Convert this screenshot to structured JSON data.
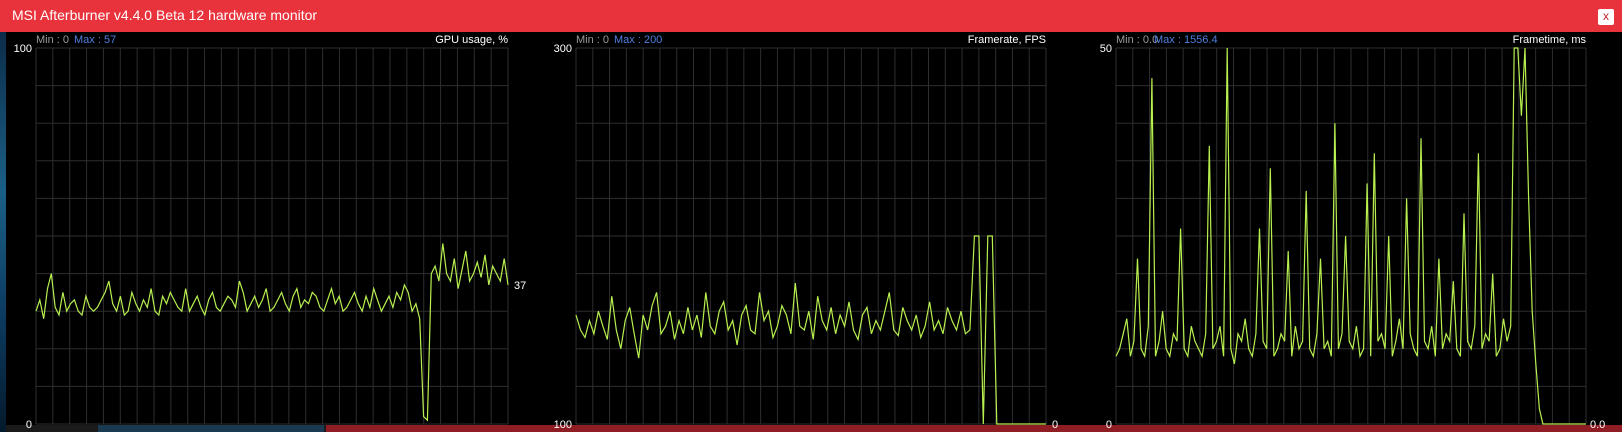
{
  "window": {
    "title": "MSI Afterburner v4.4.0 Beta 12 hardware monitor",
    "close_label": "x"
  },
  "colors": {
    "titlebar": "#e8333c",
    "trace": "#b8f050",
    "grid": "#2e2e2e",
    "text": "#ffffff",
    "min_text": "#9a9a9a",
    "max_text": "#4d7fe0"
  },
  "graphs": [
    {
      "name": "GPU usage, %",
      "min_label": "Min : 0",
      "max_label": "Max : 57",
      "y_top_label": "100",
      "y_bottom_label": "0",
      "current_value": "37"
    },
    {
      "name": "Framerate, FPS",
      "min_label": "Min : 0",
      "max_label": "Max : 200",
      "y_top_label": "300",
      "y_bottom_label": "100",
      "current_value": "0"
    },
    {
      "name": "Frametime, ms",
      "min_label": "Min : 0.0",
      "max_label": "Max : 1556.4",
      "y_top_label": "50",
      "y_bottom_label": "0",
      "current_value": "0.0"
    }
  ],
  "chart_data": [
    {
      "type": "line",
      "title": "GPU usage, %",
      "ylim": [
        0,
        100
      ],
      "grid": true,
      "series": [
        {
          "values": [
            30,
            33,
            28,
            36,
            40,
            31,
            29,
            35,
            30,
            32,
            33,
            30,
            29,
            34,
            31,
            30,
            31,
            33,
            35,
            38,
            32,
            30,
            34,
            29,
            30,
            35,
            32,
            30,
            33,
            31,
            36,
            30,
            29,
            34,
            32,
            35,
            33,
            31,
            30,
            36,
            30,
            32,
            34,
            31,
            29,
            33,
            35,
            31,
            30,
            32,
            34,
            33,
            31,
            38,
            35,
            30,
            32,
            34,
            31,
            33,
            36,
            30,
            31,
            33,
            35,
            32,
            30,
            34,
            36,
            31,
            33,
            32,
            35,
            34,
            31,
            30,
            33,
            36,
            32,
            34,
            30,
            31,
            33,
            35,
            32,
            30,
            34,
            31,
            36,
            33,
            30,
            32,
            34,
            31,
            35,
            33,
            37,
            35,
            30,
            32,
            28,
            2,
            1,
            40,
            42,
            38,
            48,
            40,
            38,
            44,
            36,
            41,
            46,
            38,
            40,
            43,
            39,
            45,
            37,
            42,
            40,
            38,
            44,
            37
          ],
          "x_end": 0
        }
      ]
    },
    {
      "type": "line",
      "title": "Framerate, FPS",
      "ylim": [
        100,
        300
      ],
      "grid": true,
      "series": [
        {
          "values": [
            158,
            150,
            146,
            155,
            148,
            160,
            152,
            145,
            168,
            150,
            140,
            155,
            162,
            148,
            135,
            158,
            150,
            163,
            170,
            148,
            152,
            160,
            145,
            155,
            148,
            162,
            150,
            158,
            146,
            170,
            152,
            148,
            160,
            165,
            150,
            155,
            142,
            158,
            163,
            150,
            148,
            170,
            155,
            160,
            146,
            152,
            163,
            158,
            148,
            175,
            152,
            150,
            160,
            145,
            168,
            155,
            150,
            162,
            148,
            158,
            152,
            165,
            150,
            145,
            158,
            162,
            148,
            155,
            150,
            160,
            170,
            150,
            147,
            162,
            155,
            150,
            158,
            146,
            152,
            165,
            150,
            155,
            148,
            162,
            155,
            150,
            160,
            148,
            150,
            200,
            200,
            0,
            200,
            200,
            0,
            0,
            0,
            0,
            0,
            0,
            0,
            0,
            0,
            0,
            0,
            0
          ]
        }
      ]
    },
    {
      "type": "line",
      "title": "Frametime, ms",
      "ylim": [
        0,
        50
      ],
      "grid": true,
      "series": [
        {
          "values": [
            9,
            10,
            12,
            14,
            9,
            11,
            22,
            10,
            9,
            13,
            46,
            9,
            11,
            15,
            10,
            9,
            12,
            11,
            26,
            10,
            9,
            13,
            11,
            10,
            9,
            12,
            37,
            10,
            11,
            13,
            9,
            50,
            10,
            8,
            12,
            11,
            14,
            10,
            9,
            12,
            26,
            11,
            10,
            34,
            9,
            10,
            12,
            11,
            23,
            9,
            13,
            10,
            11,
            31,
            10,
            9,
            12,
            22,
            10,
            11,
            9,
            40,
            10,
            12,
            25,
            11,
            10,
            13,
            9,
            10,
            32,
            9,
            36,
            11,
            12,
            10,
            25,
            9,
            11,
            14,
            10,
            30,
            12,
            10,
            9,
            38,
            11,
            10,
            13,
            9,
            22,
            10,
            12,
            11,
            19,
            10,
            9,
            28,
            11,
            10,
            13,
            36,
            10,
            12,
            11,
            20,
            9,
            10,
            14,
            11,
            13,
            50,
            50,
            41,
            50,
            30,
            15,
            8,
            2,
            0,
            0,
            0,
            0,
            0,
            0,
            0,
            0,
            0,
            0,
            0,
            0,
            0
          ]
        }
      ]
    }
  ]
}
